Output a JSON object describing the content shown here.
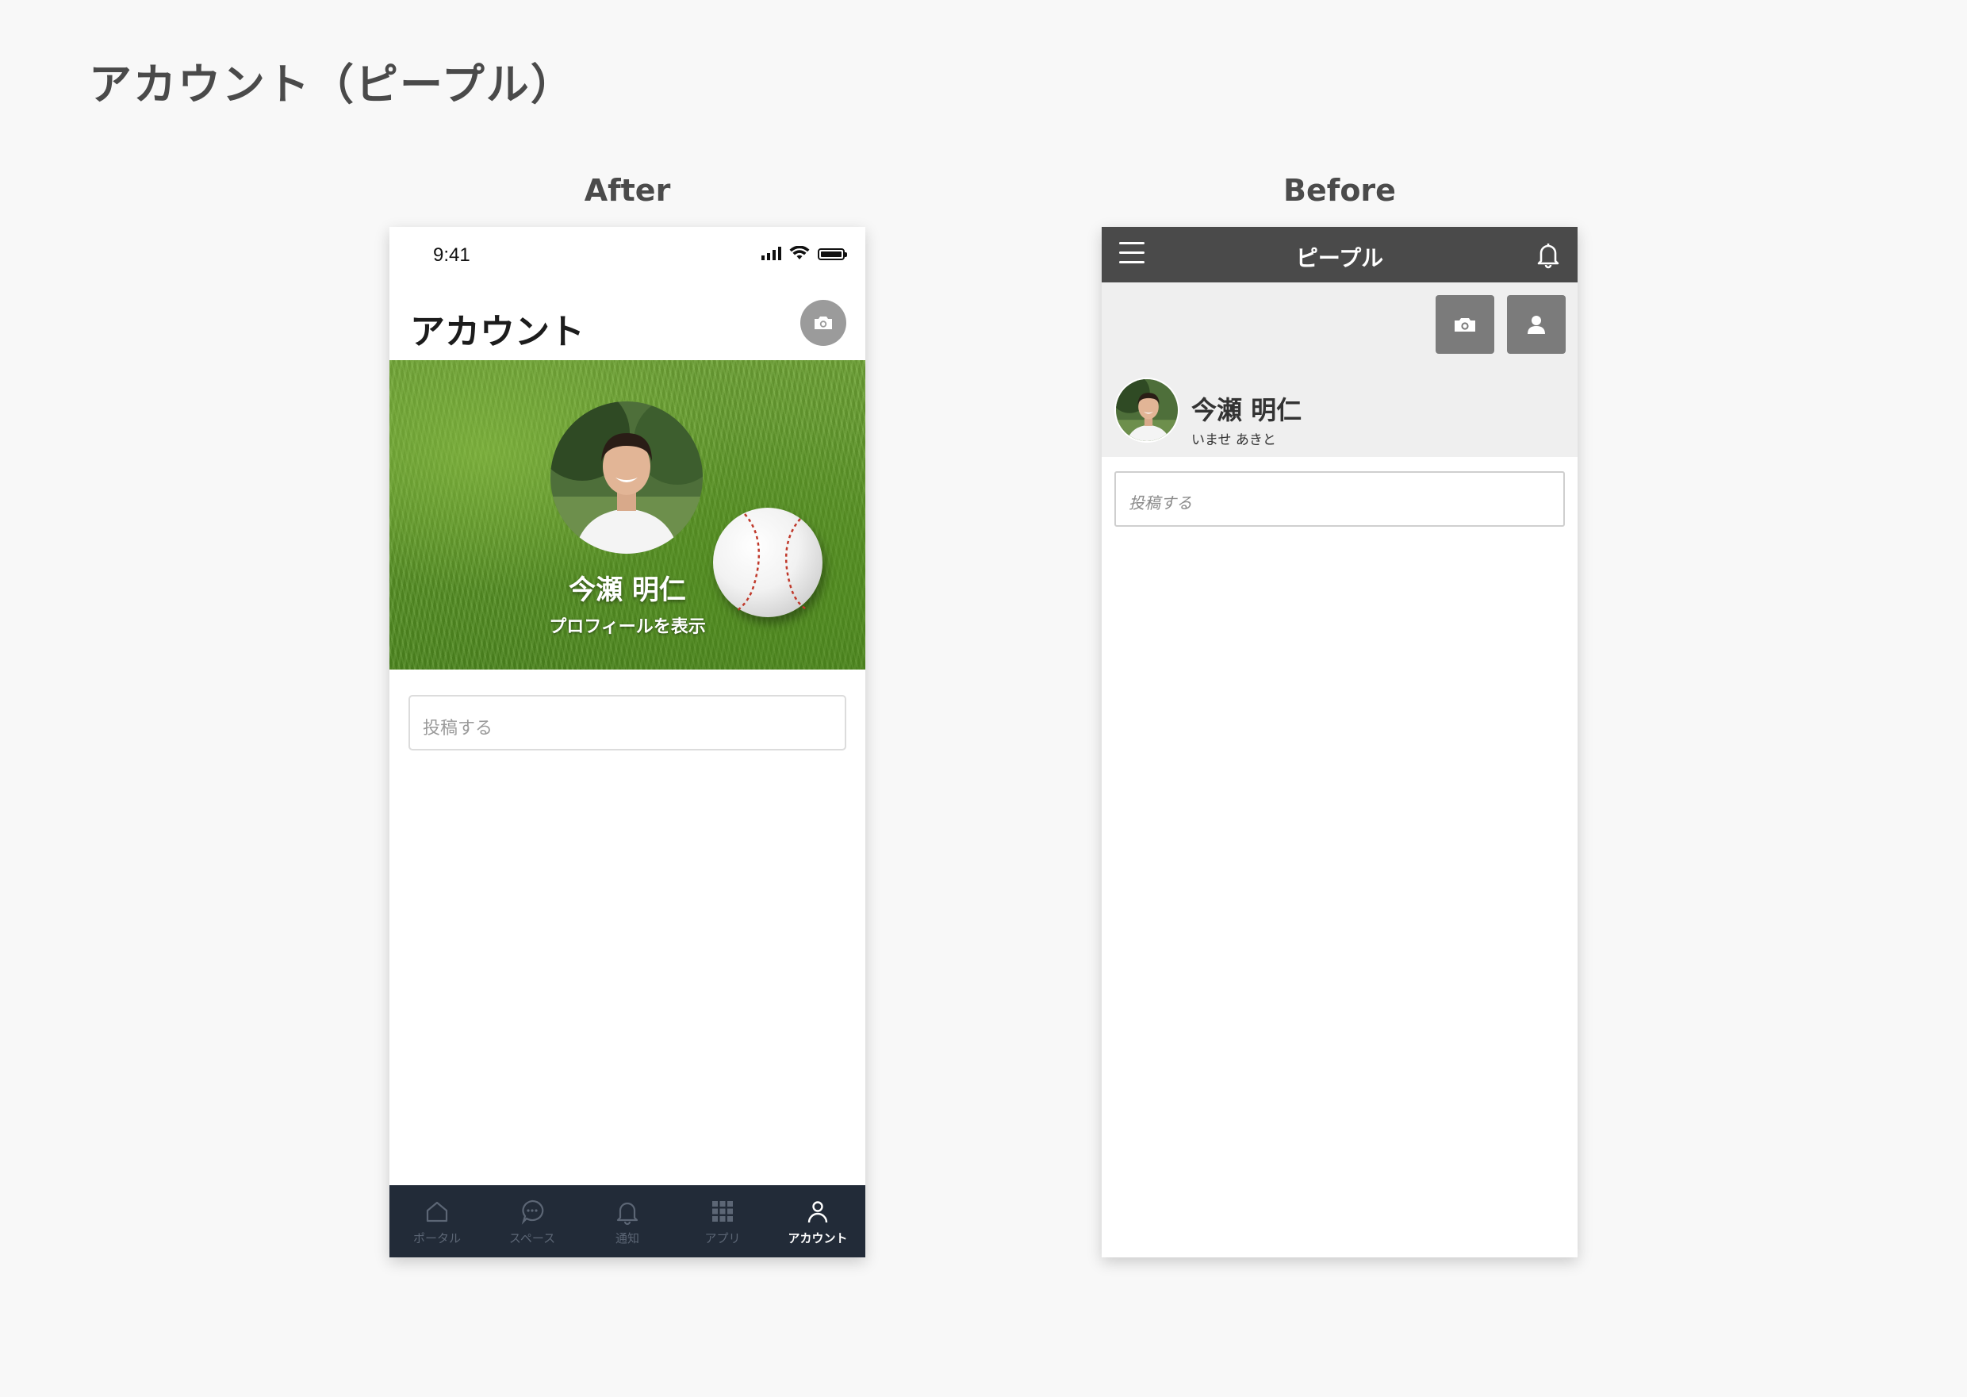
{
  "page": {
    "title": "アカウント（ピープル）"
  },
  "labels": {
    "after": "After",
    "before": "Before"
  },
  "after": {
    "status": {
      "time": "9:41"
    },
    "header": {
      "title": "アカウント"
    },
    "profile": {
      "name": "今瀬 明仁",
      "view_profile": "プロフィールを表示"
    },
    "post_placeholder": "投稿する",
    "tabs": [
      {
        "label": "ポータル",
        "icon": "home-icon",
        "active": false
      },
      {
        "label": "スペース",
        "icon": "chat-bubble-icon",
        "active": false
      },
      {
        "label": "通知",
        "icon": "bell-icon",
        "active": false
      },
      {
        "label": "アプリ",
        "icon": "grid-icon",
        "active": false
      },
      {
        "label": "アカウント",
        "icon": "person-icon",
        "active": true
      }
    ]
  },
  "before": {
    "header": {
      "title": "ピープル"
    },
    "profile": {
      "name": "今瀬 明仁",
      "kana": "いませ あきと"
    },
    "post_placeholder": "投稿する"
  },
  "colors": {
    "tabbar": "#222b38",
    "before_header": "#4a4a4a",
    "background": "#f8f8f8"
  }
}
